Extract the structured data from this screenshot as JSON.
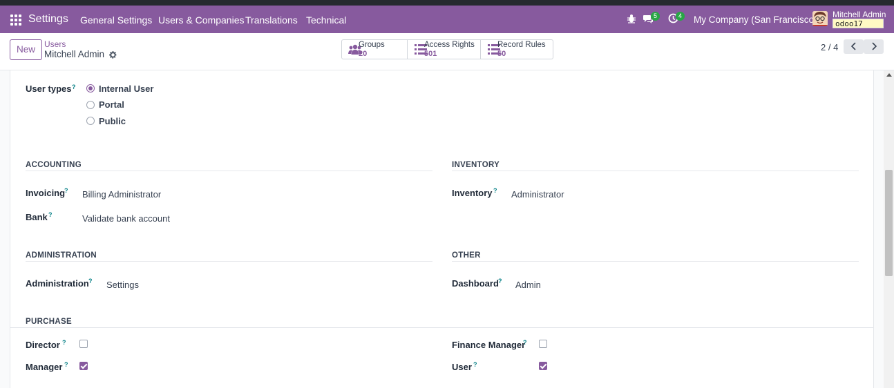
{
  "navbar": {
    "app_title": "Settings",
    "menu": [
      "General Settings",
      "Users & Companies",
      "Translations",
      "Technical"
    ],
    "messages_badge": "5",
    "activities_badge": "4",
    "company": "My Company (San Francisco)",
    "user_name": "Mitchell Admin",
    "database": "odoo17"
  },
  "control_panel": {
    "new_label": "New",
    "breadcrumb_parent": "Users",
    "breadcrumb_current": "Mitchell Admin",
    "smart_buttons": [
      {
        "label": "Groups",
        "value": "20",
        "icon": "users-icon"
      },
      {
        "label": "Access Rights",
        "value": "501",
        "icon": "list-icon"
      },
      {
        "label": "Record Rules",
        "value": "50",
        "icon": "list-icon"
      }
    ],
    "pager": "2 / 4"
  },
  "form": {
    "user_types_label": "User types",
    "help_mark": "?",
    "user_types": [
      {
        "label": "Internal User",
        "checked": true
      },
      {
        "label": "Portal",
        "checked": false
      },
      {
        "label": "Public",
        "checked": false
      }
    ],
    "sections": {
      "accounting": {
        "title": "ACCOUNTING",
        "fields": [
          {
            "label": "Invoicing",
            "value": "Billing Administrator"
          },
          {
            "label": "Bank",
            "value": "Validate bank account"
          }
        ]
      },
      "inventory": {
        "title": "INVENTORY",
        "fields": [
          {
            "label": "Inventory",
            "value": "Administrator"
          }
        ]
      },
      "administration": {
        "title": "ADMINISTRATION",
        "fields": [
          {
            "label": "Administration",
            "value": "Settings"
          }
        ]
      },
      "other": {
        "title": "OTHER",
        "fields": [
          {
            "label": "Dashboard",
            "value": "Admin"
          }
        ]
      },
      "purchase": {
        "title": "PURCHASE",
        "left": [
          {
            "label": "Director",
            "checked": false
          },
          {
            "label": "Manager",
            "checked": true
          }
        ],
        "right": [
          {
            "label": "Finance Manager",
            "checked": false
          },
          {
            "label": "User",
            "checked": true
          }
        ]
      }
    }
  },
  "colors": {
    "brand": "#875a9e",
    "help": "#017e84",
    "badge": "#28a745"
  }
}
